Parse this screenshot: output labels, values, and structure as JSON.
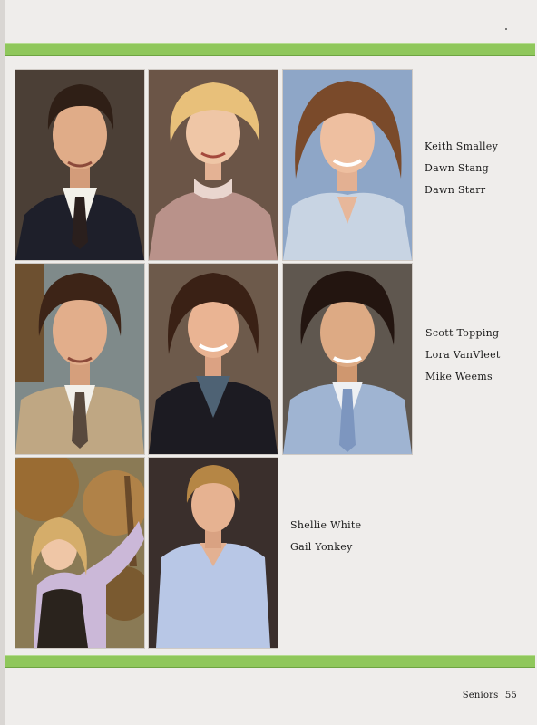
{
  "rows": [
    {
      "names": [
        "Keith Smalley",
        "Dawn Stang",
        "Dawn Starr"
      ]
    },
    {
      "names": [
        "Scott Topping",
        "Lora VanVleet",
        "Mike Weems"
      ]
    },
    {
      "names": [
        "Shellie White",
        "Gail Yonkey"
      ]
    }
  ],
  "footer": {
    "section": "Seniors",
    "page_number": "55"
  },
  "colors": {
    "band": "#8fc75b",
    "paper": "#efedeb",
    "text": "#1b1b1b"
  }
}
